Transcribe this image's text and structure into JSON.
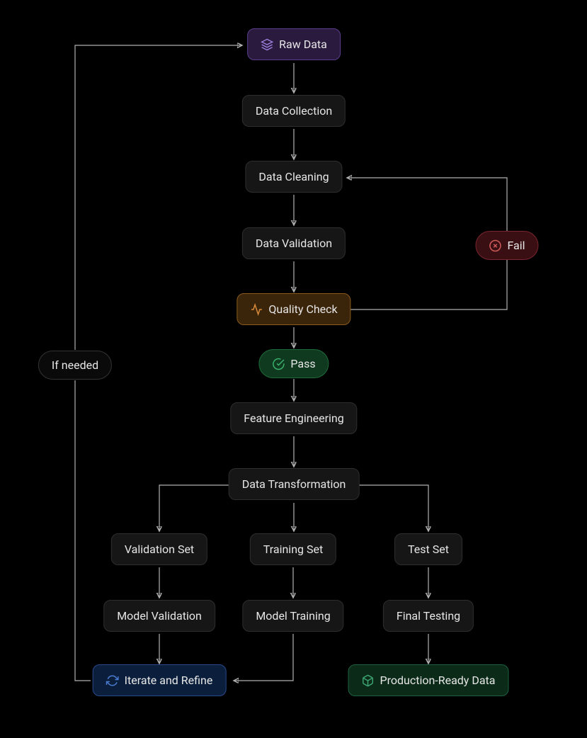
{
  "nodes": {
    "raw_data": "Raw Data",
    "data_collection": "Data Collection",
    "data_cleaning": "Data Cleaning",
    "data_validation": "Data Validation",
    "quality_check": "Quality Check",
    "pass": "Pass",
    "fail": "Fail",
    "if_needed": "If needed",
    "feature_engineering": "Feature Engineering",
    "data_transformation": "Data Transformation",
    "validation_set": "Validation Set",
    "training_set": "Training Set",
    "test_set": "Test Set",
    "model_validation": "Model Validation",
    "model_training": "Model Training",
    "final_testing": "Final Testing",
    "iterate_refine": "Iterate and Refine",
    "production_ready": "Production-Ready Data"
  },
  "icons": {
    "layers": "layers-icon",
    "activity": "activity-icon",
    "check_circle": "check-circle-icon",
    "x_circle": "x-circle-icon",
    "refresh": "refresh-icon",
    "box": "box-icon"
  },
  "colors": {
    "purple_border": "#5a3d8a",
    "orange_border": "#8a5a1a",
    "green_border": "#1e6a3a",
    "red_border": "#7a2530",
    "blue_border": "#2a4a8a"
  }
}
